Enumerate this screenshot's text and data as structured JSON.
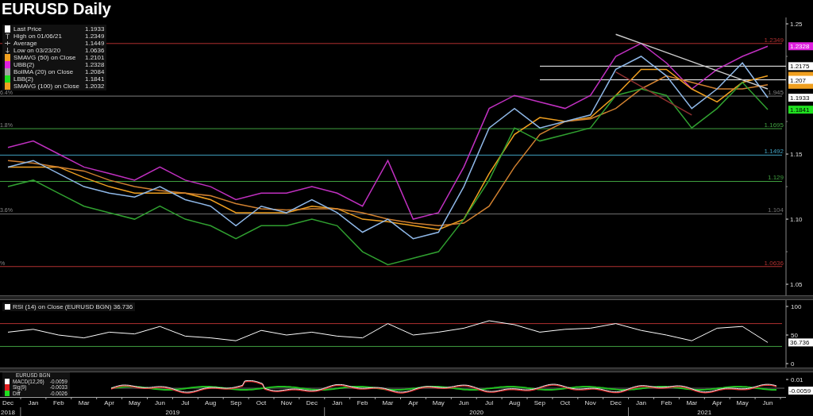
{
  "title": "EURUSD Daily",
  "price_panel": {
    "legend": [
      {
        "kind": "swatch",
        "color": "#ffffff",
        "label": "Last Price",
        "value": "1.1933"
      },
      {
        "kind": "high",
        "label": "High on 01/06/21",
        "value": "1.2349"
      },
      {
        "kind": "average",
        "label": "Average",
        "value": "1.1449"
      },
      {
        "kind": "low",
        "label": "Low on 03/23/20",
        "value": "1.0636"
      },
      {
        "kind": "swatch",
        "color": "#f0a020",
        "label": "SMAVG (50)  on Close",
        "value": "1.2101"
      },
      {
        "kind": "swatch",
        "color": "#e020e0",
        "label": "UBB(2)",
        "value": "1.2328"
      },
      {
        "kind": "swatch",
        "color": "#a0a0a0",
        "label": "BollMA (20)  on Close",
        "value": "1.2084"
      },
      {
        "kind": "swatch",
        "color": "#20e020",
        "label": "LBB(2)",
        "value": "1.1841"
      },
      {
        "kind": "swatch",
        "color": "#f0a020",
        "label": "SMAVG (100)  on Close",
        "value": "1.2032"
      }
    ],
    "chart_data": {
      "type": "line",
      "ylim": [
        1.0415,
        1.2549
      ],
      "yticks": [
        1.05,
        {
          "value": 1.1,
          "label": "1.10"
        },
        1.15,
        1.25
      ],
      "series": [
        {
          "color": "#c030c0",
          "values": [
            1.155,
            1.16,
            1.15,
            1.14,
            1.135,
            1.13,
            1.14,
            1.13,
            1.125,
            1.115,
            1.12,
            1.12,
            1.125,
            1.12,
            1.11,
            1.145,
            1.1,
            1.105,
            1.14,
            1.185,
            1.195,
            1.19,
            1.185,
            1.195,
            1.225,
            1.235,
            1.22,
            1.2,
            1.215,
            1.225,
            1.2328
          ]
        },
        {
          "color": "#f0a020",
          "values": [
            1.14,
            1.14,
            1.14,
            1.132,
            1.125,
            1.12,
            1.12,
            1.12,
            1.115,
            1.105,
            1.105,
            1.105,
            1.11,
            1.108,
            1.1,
            1.098,
            1.095,
            1.092,
            1.1,
            1.135,
            1.165,
            1.178,
            1.175,
            1.178,
            1.195,
            1.215,
            1.215,
            1.2,
            1.19,
            1.205,
            1.2101
          ]
        },
        {
          "color": "#d08030",
          "values": [
            1.145,
            1.143,
            1.14,
            1.137,
            1.13,
            1.125,
            1.122,
            1.12,
            1.118,
            1.112,
            1.108,
            1.107,
            1.108,
            1.108,
            1.105,
            1.1,
            1.097,
            1.095,
            1.097,
            1.11,
            1.14,
            1.165,
            1.175,
            1.177,
            1.185,
            1.2,
            1.21,
            1.205,
            1.2,
            1.2,
            1.2032
          ]
        },
        {
          "color": "#8fb8e8",
          "values": [
            1.14,
            1.145,
            1.135,
            1.125,
            1.12,
            1.117,
            1.125,
            1.115,
            1.11,
            1.095,
            1.11,
            1.105,
            1.115,
            1.105,
            1.09,
            1.1,
            1.085,
            1.09,
            1.125,
            1.17,
            1.185,
            1.17,
            1.175,
            1.18,
            1.215,
            1.225,
            1.21,
            1.185,
            1.2,
            1.22,
            1.1933
          ]
        },
        {
          "color": "#30a030",
          "values": [
            1.125,
            1.13,
            1.12,
            1.11,
            1.105,
            1.1,
            1.11,
            1.1,
            1.095,
            1.085,
            1.095,
            1.095,
            1.1,
            1.095,
            1.075,
            1.065,
            1.07,
            1.075,
            1.1,
            1.13,
            1.17,
            1.16,
            1.165,
            1.17,
            1.195,
            1.2,
            1.195,
            1.17,
            1.185,
            1.205,
            1.1841
          ]
        },
        {
          "color": "#cccccc",
          "values": [
            null,
            null,
            null,
            null,
            null,
            null,
            null,
            null,
            null,
            null,
            null,
            null,
            null,
            null,
            null,
            null,
            null,
            null,
            null,
            null,
            null,
            null,
            null,
            null,
            1.242,
            1.235,
            1.228,
            1.221,
            1.214,
            1.207,
            1.2
          ]
        },
        {
          "color": "#903030",
          "values": [
            null,
            null,
            null,
            null,
            null,
            null,
            null,
            null,
            null,
            null,
            null,
            null,
            null,
            null,
            null,
            null,
            null,
            null,
            null,
            null,
            null,
            null,
            null,
            null,
            1.213,
            1.202,
            1.191,
            1.18,
            null,
            null,
            null
          ]
        }
      ],
      "ref_lines": [
        {
          "axis": "y",
          "value": 1.2349,
          "label": "1.2349",
          "color": "#b03030"
        },
        {
          "axis": "y",
          "value": 1.2175,
          "label": "1.2175",
          "color": "#ffffff"
        },
        {
          "axis": "y",
          "value": 1.207,
          "label": "1.207",
          "color": "#ffffff"
        },
        {
          "axis": "y",
          "value": 1.1945,
          "color": "#808080"
        },
        {
          "axis": "y",
          "value": 1.1695,
          "label": "1.1695",
          "color": "#40a040"
        },
        {
          "axis": "y",
          "value": 1.1492,
          "label": "1.1492",
          "color": "#40a0c0"
        },
        {
          "axis": "y",
          "value": 1.129,
          "label": "1.129",
          "color": "#40a040"
        },
        {
          "axis": "y",
          "value": 1.104,
          "label": "1.104",
          "color": "#707070"
        },
        {
          "axis": "y",
          "value": 1.0636,
          "label": "1.0636",
          "color": "#b03030"
        }
      ],
      "annotations": [
        {
          "text": "6.4%",
          "y": 1.1945
        },
        {
          "text": "1.8%",
          "y": 1.1695
        },
        {
          "text": "3.6%",
          "y": 1.104
        },
        {
          "text": "%",
          "y": 1.0636
        }
      ]
    },
    "cut_level_labels": [
      {
        "text": "1.945"
      }
    ],
    "end_tags": [
      {
        "label": "1.2328",
        "color": "#e020e0"
      },
      {
        "color": "#f0a020"
      },
      {
        "color": "#f0a020"
      },
      {
        "label": "1.1933",
        "color": "#ffffff"
      },
      {
        "label": "1.1841",
        "color": "#20e020"
      }
    ]
  },
  "rsi_panel": {
    "legend": {
      "color": "#ffffff",
      "label": "RSI (14)  on Close (EURUSD BGN) 36.736"
    },
    "chart_data": {
      "type": "line",
      "ylim": [
        -6.94,
        111.11
      ],
      "yticks": [
        0,
        50,
        100
      ],
      "series": [
        {
          "color": "#ffffff",
          "values": [
            55,
            60,
            50,
            45,
            55,
            52,
            65,
            48,
            45,
            40,
            58,
            50,
            55,
            48,
            45,
            70,
            50,
            55,
            62,
            75,
            68,
            55,
            60,
            62,
            70,
            58,
            50,
            40,
            62,
            65,
            37
          ]
        }
      ],
      "ref_lines": [
        {
          "axis": "y",
          "value": 70,
          "color": "#b03030"
        },
        {
          "axis": "y",
          "value": 30,
          "color": "#40a040"
        }
      ]
    },
    "end_tag": {
      "label": "36.736",
      "color": "#ffffff"
    }
  },
  "macd_panel": {
    "title": "EURUSD BGN",
    "legend": [
      {
        "color": "#ffffff",
        "label": "MACD(12,26)",
        "value": "-0.0059"
      },
      {
        "color": "#e02020",
        "label": "Sig(9)",
        "value": "-0.0033"
      },
      {
        "color": "#20e020",
        "label": "Diff",
        "value": "-0.0026"
      }
    ],
    "axis_label": "0.01",
    "value_tag": "-0.0059"
  },
  "time_axis": {
    "years": [
      {
        "label": "2018",
        "months": [
          "Dec"
        ]
      },
      {
        "label": "2019",
        "months": [
          "Jan",
          "Feb",
          "Mar",
          "Apr",
          "May",
          "Jun",
          "Jul",
          "Aug",
          "Sep",
          "Oct",
          "Nov",
          "Dec"
        ]
      },
      {
        "label": "2020",
        "months": [
          "Jan",
          "Feb",
          "Mar",
          "Apr",
          "May",
          "Jun",
          "Jul",
          "Aug",
          "Sep",
          "Oct",
          "Nov",
          "Dec"
        ]
      },
      {
        "label": "2021",
        "months": [
          "Jan",
          "Feb",
          "Mar",
          "Apr",
          "May",
          "Jun"
        ]
      }
    ]
  }
}
